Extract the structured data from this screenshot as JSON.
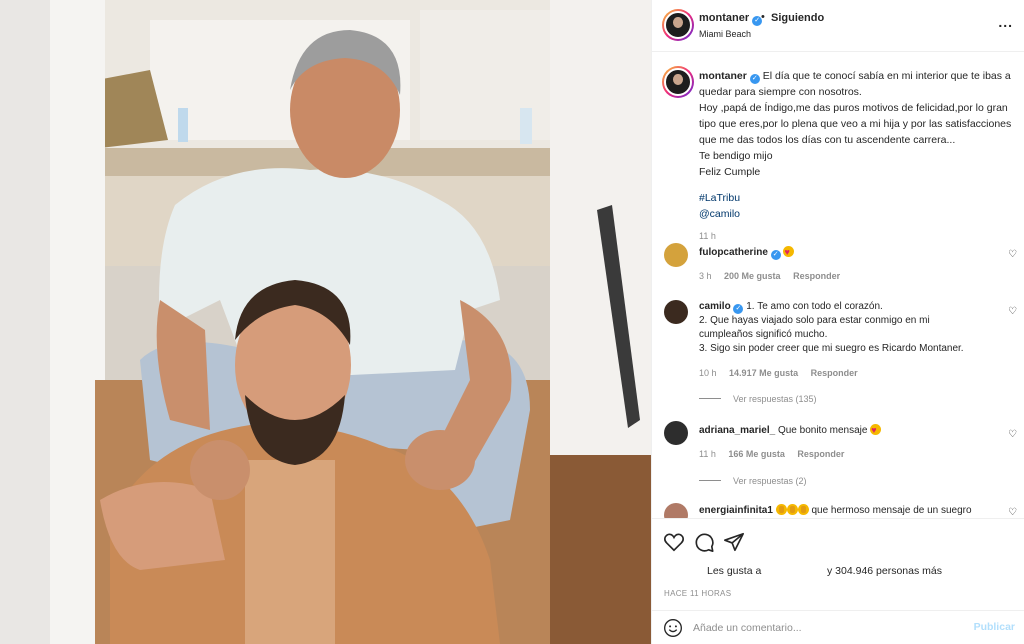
{
  "post": {
    "author": "montaner",
    "follow_status": "Siguiendo",
    "location": "Miami Beach",
    "more": "...",
    "caption": {
      "lines": [
        "El día que te conocí sabía en mi interior que te ibas a",
        "quedar para siempre con nosotros.",
        "Hoy ,papá de Índigo,me das puros motivos de felicidad,por lo gran",
        "tipo que eres,por lo plena que veo a mi hija y por las satisfacciones",
        "que me das todos los días con tu ascendente carrera...",
        "Te bendigo mijo",
        "Feliz Cumple"
      ],
      "hashtag": "#LaTribu",
      "mention": "@camilo",
      "time": "11 h"
    }
  },
  "comments": [
    {
      "user": "fulopcatherine",
      "verified": true,
      "emoji": "heart-eyes-emoji",
      "text": "",
      "time": "3 h",
      "likes": "200 Me gusta",
      "reply": "Responder"
    },
    {
      "user": "camilo",
      "verified": true,
      "lines": [
        "1. Te amo con todo el corazón.",
        "2. Que hayas viajado solo para estar conmigo en mi",
        "cumpleaños significó mucho.",
        "3. Sigo sin poder creer que mi suegro es Ricardo Montaner."
      ],
      "time": "10 h",
      "likes": "14.917 Me gusta",
      "reply": "Responder",
      "view_replies": "Ver respuestas (135)"
    },
    {
      "user": "adriana_mariel_",
      "text": "Que bonito mensaje",
      "emoji": "heart-eyes-emoji",
      "time": "11 h",
      "likes": "166 Me gusta",
      "reply": "Responder",
      "view_replies": "Ver respuestas (2)"
    },
    {
      "user": "energiainfinita1",
      "text": "que hermoso mensaje de un suegro",
      "emoji": "clap-emoji"
    }
  ],
  "actions": {
    "likes_prefix": "Les gusta a",
    "likes_count": "y 304.946 personas más",
    "timestamp": "HACE 11 HORAS"
  },
  "add_comment": {
    "placeholder": "Añade un comentario...",
    "post_label": "Publicar"
  },
  "colors": {
    "verified": "#3897f0",
    "link": "#00376b",
    "muted": "#8e8e8e",
    "post_disabled": "#b2dffc"
  }
}
